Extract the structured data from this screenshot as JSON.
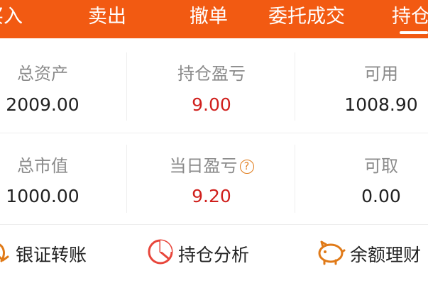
{
  "tabs": [
    {
      "label": "买入"
    },
    {
      "label": "卖出"
    },
    {
      "label": "撤单"
    },
    {
      "label": "委托成交"
    },
    {
      "label": "持仓"
    }
  ],
  "summary": {
    "total_assets": {
      "label": "总资产",
      "value": "2009.00"
    },
    "position_pl": {
      "label": "持仓盈亏",
      "value": "9.00"
    },
    "available": {
      "label": "可用",
      "value": "1008.90"
    },
    "market_value": {
      "label": "总市值",
      "value": "1000.00"
    },
    "daily_pl": {
      "label": "当日盈亏",
      "value": "9.20",
      "help": "?"
    },
    "withdrawable": {
      "label": "可取",
      "value": "0.00"
    }
  },
  "actions": [
    {
      "label": "银证转账",
      "icon": "bank-transfer-icon"
    },
    {
      "label": "持仓分析",
      "icon": "pie-chart-icon"
    },
    {
      "label": "余额理财",
      "icon": "piggy-bank-icon"
    }
  ],
  "colors": {
    "header_orange": "#f25a12",
    "profit_red": "#d0201d",
    "icon_orange": "#e07a18",
    "icon_red": "#e8463b"
  }
}
